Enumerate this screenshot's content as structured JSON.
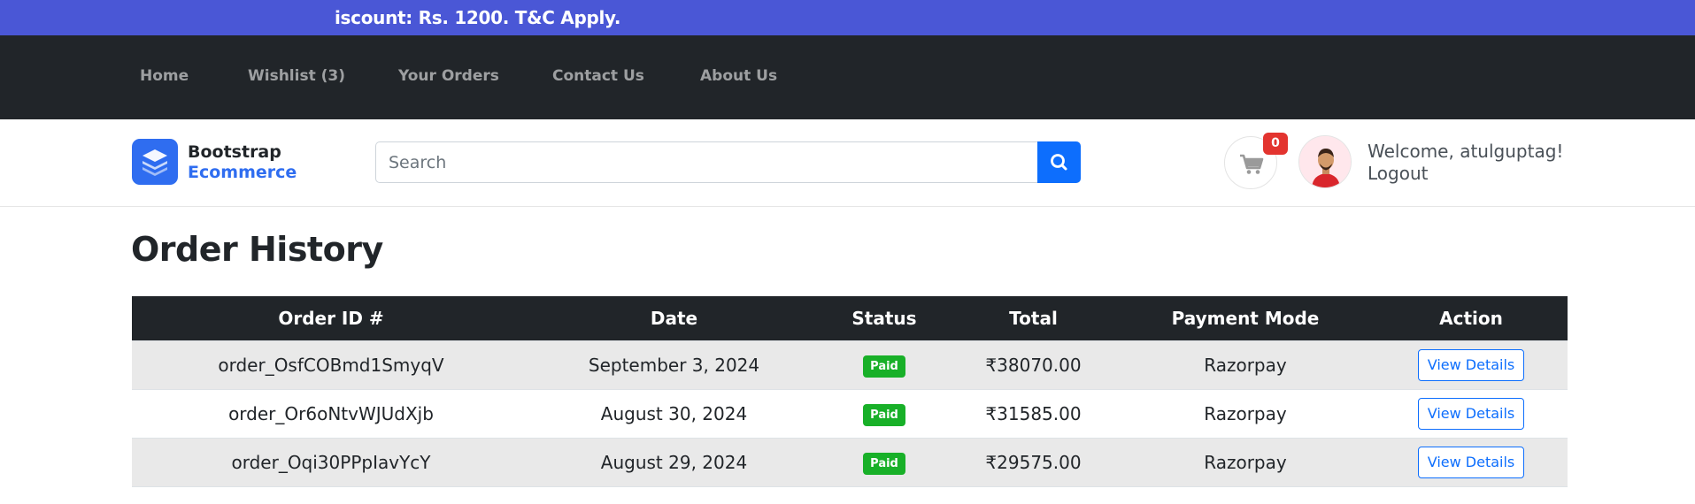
{
  "announcement": {
    "text": "iscount: Rs. 1200. T&C Apply."
  },
  "nav": {
    "items": [
      {
        "label": "Home"
      },
      {
        "label": "Wishlist (3)"
      },
      {
        "label": "Your Orders"
      },
      {
        "label": "Contact Us"
      },
      {
        "label": "About Us"
      }
    ]
  },
  "header": {
    "logo": {
      "line1": "Bootstrap",
      "line2": "Ecommerce",
      "icon": "stacked-layers-icon"
    },
    "search": {
      "placeholder": "Search",
      "value": "",
      "icon": "search-icon"
    },
    "cart": {
      "count": "0",
      "icon": "cart-icon"
    },
    "user": {
      "welcome": "Welcome, atulguptag!",
      "logout": "Logout",
      "avatar_icon": "avatar-icon"
    }
  },
  "main": {
    "title": "Order History",
    "table": {
      "headers": [
        "Order ID #",
        "Date",
        "Status",
        "Total",
        "Payment Mode",
        "Action"
      ],
      "rows": [
        {
          "order_id": "order_OsfCOBmd1SmyqV",
          "date": "September 3, 2024",
          "status": "Paid",
          "total": "₹38070.00",
          "payment_mode": "Razorpay",
          "action": "View Details"
        },
        {
          "order_id": "order_Or6oNtvWJUdXjb",
          "date": "August 30, 2024",
          "status": "Paid",
          "total": "₹31585.00",
          "payment_mode": "Razorpay",
          "action": "View Details"
        },
        {
          "order_id": "order_Oqi30PPpIavYcY",
          "date": "August 29, 2024",
          "status": "Paid",
          "total": "₹29575.00",
          "payment_mode": "Razorpay",
          "action": "View Details"
        }
      ]
    }
  },
  "colors": {
    "announce_bg": "#4a57d6",
    "nav_bg": "#212529",
    "primary": "#0d6efd",
    "brand_blue": "#2f6df0",
    "paid_green": "#18b028",
    "badge_red": "#e3342f"
  }
}
